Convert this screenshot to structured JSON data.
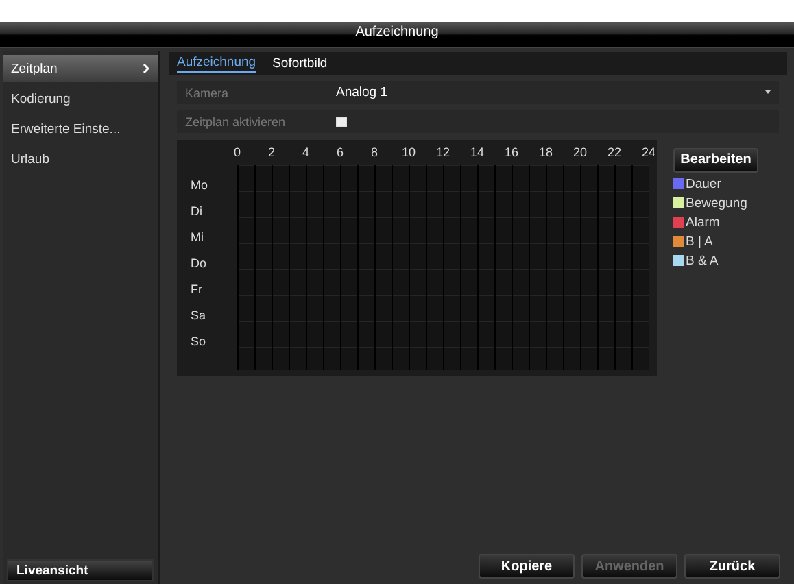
{
  "window": {
    "title": "Aufzeichnung"
  },
  "sidebar": {
    "items": [
      {
        "label": "Zeitplan",
        "selected": true
      },
      {
        "label": "Kodierung",
        "selected": false
      },
      {
        "label": "Erweiterte Einste...",
        "selected": false
      },
      {
        "label": "Urlaub",
        "selected": false
      }
    ],
    "footer_button": "Liveansicht"
  },
  "tabs": [
    {
      "label": "Aufzeichnung",
      "selected": true
    },
    {
      "label": "Sofortbild",
      "selected": false
    }
  ],
  "fields": [
    {
      "kind": "dropdown",
      "label": "Kamera",
      "value": "Analog 1"
    },
    {
      "kind": "checkbox",
      "label": "Zeitplan aktivieren",
      "checked": false
    }
  ],
  "schedule": {
    "hours": [
      "0",
      "2",
      "4",
      "6",
      "8",
      "10",
      "12",
      "14",
      "16",
      "18",
      "20",
      "22",
      "24"
    ],
    "days": [
      "Mo",
      "Di",
      "Mi",
      "Do",
      "Fr",
      "Sa",
      "So"
    ]
  },
  "edit_button": "Bearbeiten",
  "legend": [
    {
      "label": "Dauer",
      "color": "#6a6af0"
    },
    {
      "label": "Bewegung",
      "color": "#d8f0a0"
    },
    {
      "label": "Alarm",
      "color": "#e04050"
    },
    {
      "label": "B | A",
      "color": "#e08a3a"
    },
    {
      "label": "B & A",
      "color": "#a8d8f0"
    }
  ],
  "buttons": [
    {
      "label": "Kopiere",
      "disabled": false
    },
    {
      "label": "Anwenden",
      "disabled": true
    },
    {
      "label": "Zurück",
      "disabled": false
    }
  ]
}
